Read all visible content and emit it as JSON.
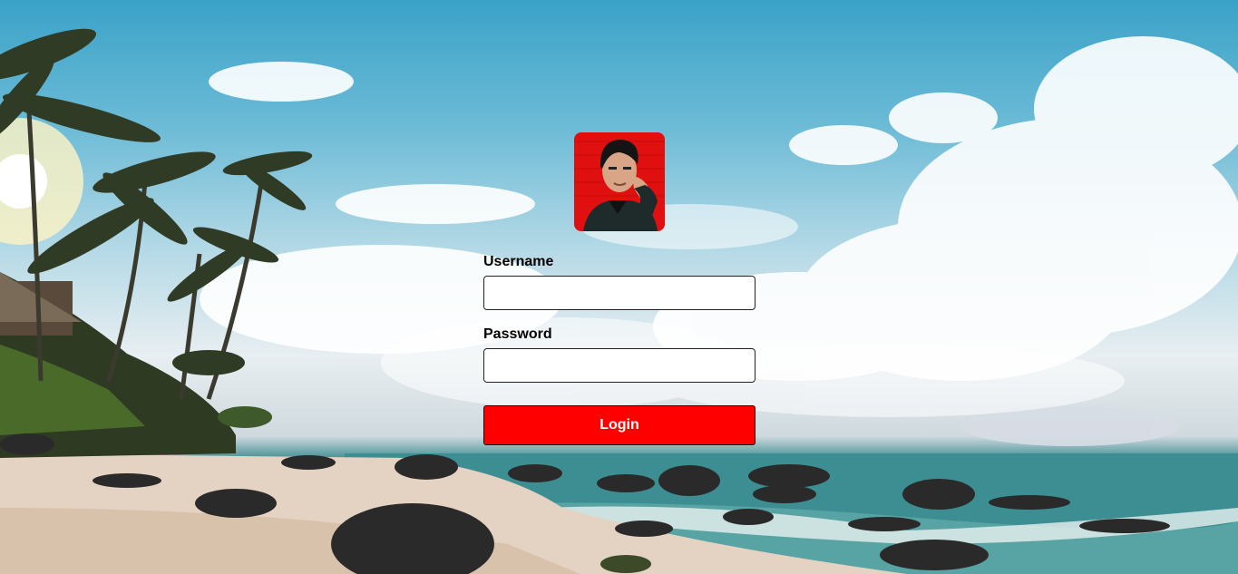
{
  "login_form": {
    "username_label": "Username",
    "username_value": "",
    "password_label": "Password",
    "password_value": "",
    "login_button_label": "Login"
  },
  "colors": {
    "login_button": "#ff0000",
    "avatar_background": "#e01010"
  }
}
